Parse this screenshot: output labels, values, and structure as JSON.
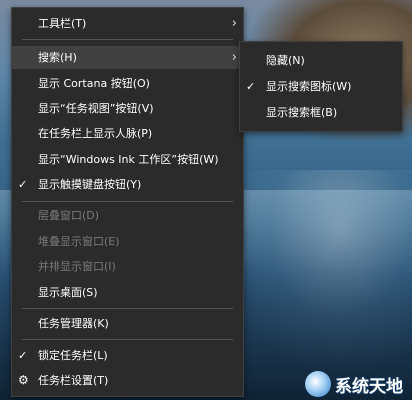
{
  "context_menu": {
    "items": [
      {
        "label": "工具栏(T)"
      },
      {
        "label": "搜索(H)"
      },
      {
        "label": "显示 Cortana 按钮(O)"
      },
      {
        "label": "显示“任务视图”按钮(V)"
      },
      {
        "label": "在任务栏上显示人脉(P)"
      },
      {
        "label": "显示“Windows Ink 工作区”按钮(W)"
      },
      {
        "label": "显示触摸键盘按钮(Y)",
        "checked": true
      },
      {
        "label": "层叠窗口(D)",
        "disabled": true
      },
      {
        "label": "堆叠显示窗口(E)",
        "disabled": true
      },
      {
        "label": "并排显示窗口(I)",
        "disabled": true
      },
      {
        "label": "显示桌面(S)"
      },
      {
        "label": "任务管理器(K)"
      },
      {
        "label": "锁定任务栏(L)",
        "checked": true
      },
      {
        "label": "任务栏设置(T)",
        "icon": "gear-icon"
      }
    ]
  },
  "search_submenu": {
    "items": [
      {
        "label": "隐藏(N)"
      },
      {
        "label": "显示搜索图标(W)",
        "checked": true
      },
      {
        "label": "显示搜索框(B)"
      }
    ]
  },
  "watermark": {
    "text": "系统天地"
  },
  "icons": {
    "checkmark": "checkmark-icon",
    "submenu": "chevron-right-icon",
    "settings": "gear-icon"
  }
}
